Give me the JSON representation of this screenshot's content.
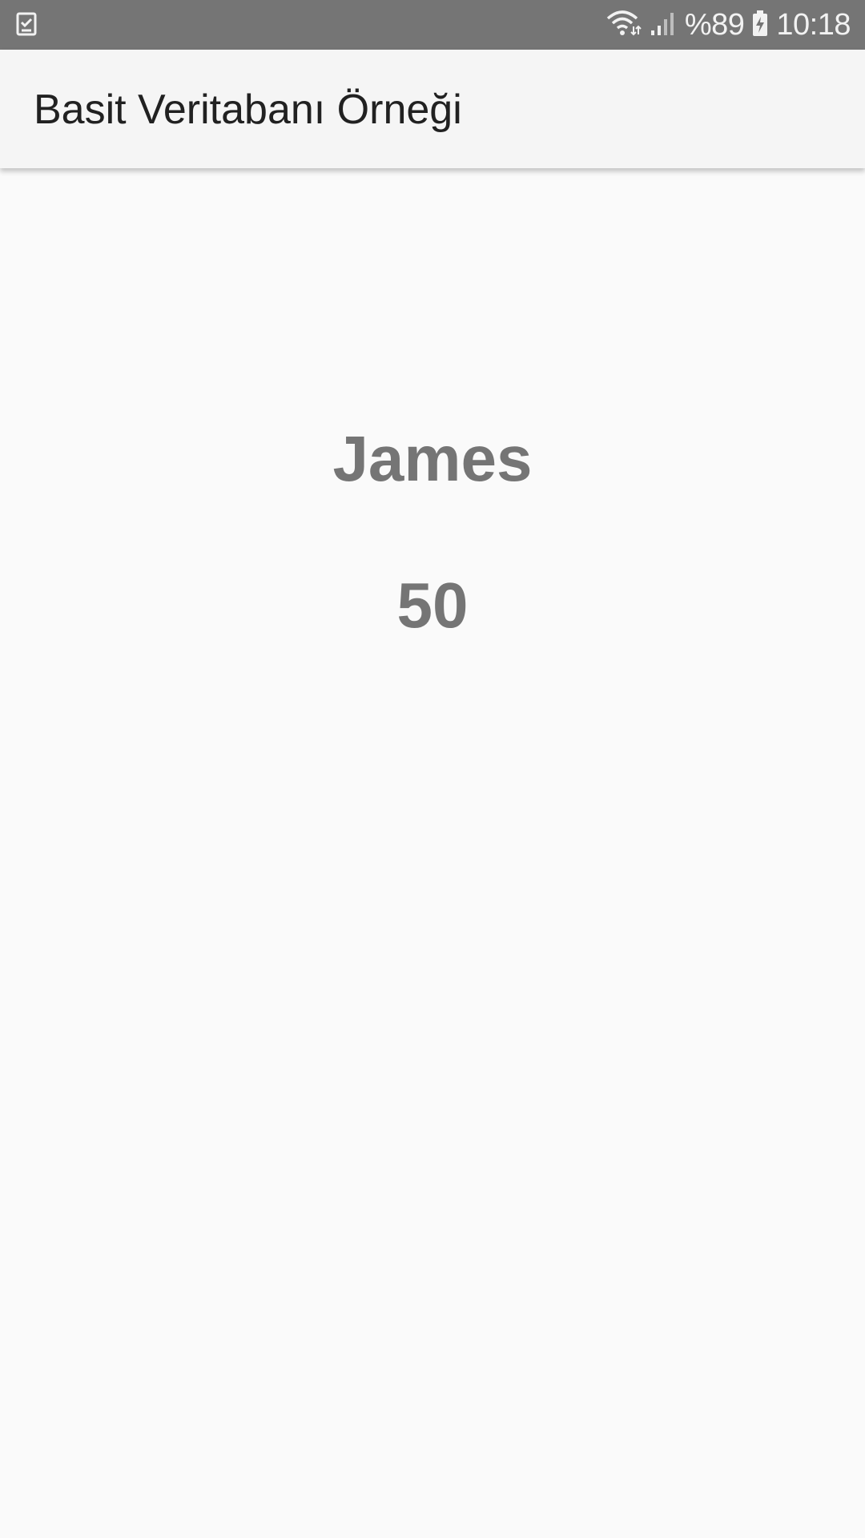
{
  "status_bar": {
    "battery_level": "%89",
    "time": "10:18",
    "icons": [
      "task-check-icon",
      "wifi-icon",
      "signal-icon",
      "battery-charging-icon"
    ],
    "background_color": "#757575"
  },
  "app_bar": {
    "title": "Basit Veritabanı Örneği",
    "background_color": "#f5f5f5"
  },
  "main": {
    "name": "James",
    "age": "50",
    "text_color": "#757575"
  }
}
